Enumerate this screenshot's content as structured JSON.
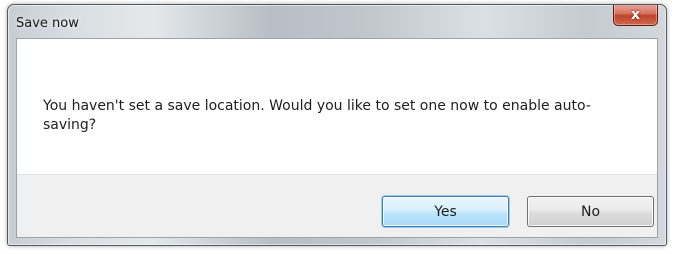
{
  "dialog": {
    "title": "Save now",
    "close_glyph": "x",
    "close_icon": "close-icon",
    "message": "You haven't set a save location. Would you like to set one now to enable auto-saving?",
    "buttons": {
      "yes_label": "Yes",
      "no_label": "No"
    }
  },
  "colors": {
    "close_button": "#c75a43",
    "default_button_border": "#3c7fb1",
    "footer_background": "#f0f0f0"
  }
}
